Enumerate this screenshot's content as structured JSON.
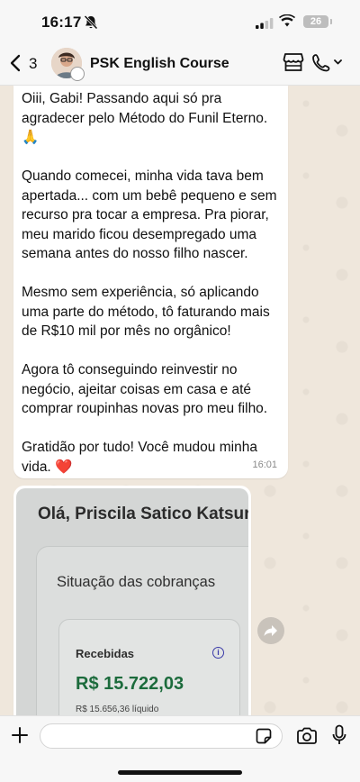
{
  "status_bar": {
    "time": "16:17",
    "battery": "26"
  },
  "header": {
    "back_count": "3",
    "title": "PSK English Course"
  },
  "message": {
    "paragraphs": [
      "Oiii, Gabi! Passando aqui só pra agradecer pelo Método do Funil Eterno. 🙏",
      "Quando comecei, minha vida tava bem apertada... com um bebê pequeno e sem recurso pra tocar a empresa. Pra piorar, meu marido ficou desempregado uma semana antes do nosso filho nascer.",
      "Mesmo sem experiência, só aplicando uma parte do método, tô faturando mais de R$10 mil por mês no orgânico!",
      "Agora tô conseguindo reinvestir no negócio, ajeitar coisas em casa e até comprar roupinhas novas pro meu filho.",
      "Gratidão por tudo! Você mudou minha vida."
    ],
    "heart": "❤️",
    "time": "16:01"
  },
  "image_message": {
    "greeting": "Olá, Priscila Satico Katsura",
    "card_title": "Situação das cobranças",
    "received_label": "Recebidas",
    "amount": "R$ 15.722,03",
    "net": "R$ 15.656,36 líquido"
  },
  "input": {
    "value": "",
    "placeholder": ""
  }
}
